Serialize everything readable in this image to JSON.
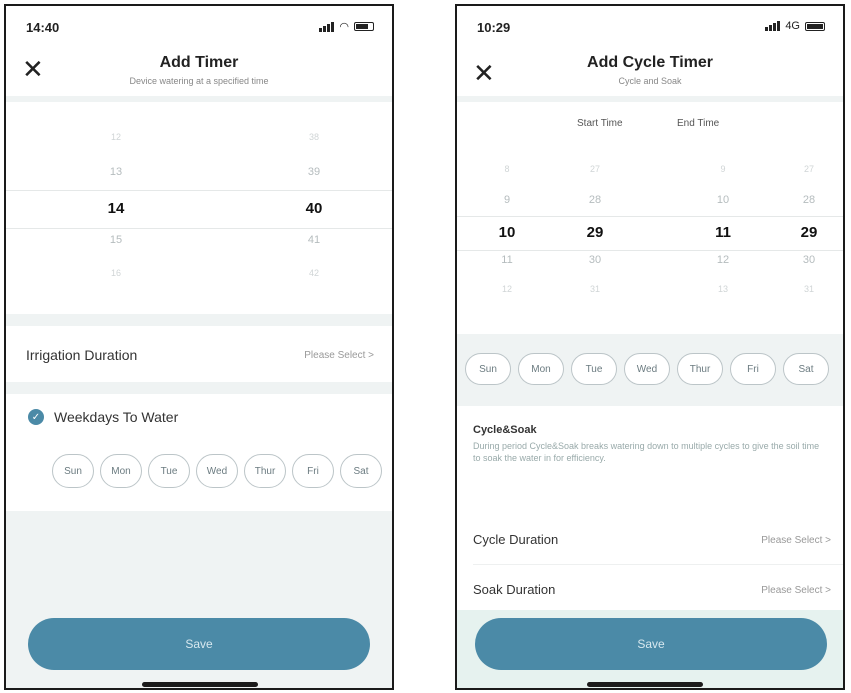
{
  "left": {
    "status": {
      "time": "14:40"
    },
    "header": {
      "title": "Add Timer",
      "subtitle": "Device watering at a specified time"
    },
    "picker": {
      "hours": [
        "12",
        "13",
        "14",
        "15",
        "16"
      ],
      "minutes": [
        "38",
        "39",
        "40",
        "41",
        "42"
      ],
      "selected_index": 2
    },
    "irrigation_duration": {
      "label": "Irrigation Duration",
      "value": "Please Select >"
    },
    "weekdays": {
      "label": "Weekdays To Water",
      "checked": true,
      "days": [
        "Sun",
        "Mon",
        "Tue",
        "Wed",
        "Thur",
        "Fri",
        "Sat"
      ]
    },
    "save_label": "Save"
  },
  "right": {
    "status": {
      "time": "10:29",
      "network": "4G"
    },
    "header": {
      "title": "Add Cycle Timer",
      "subtitle": "Cycle and Soak"
    },
    "picker": {
      "start_label": "Start Time",
      "end_label": "End Time",
      "start_hours": [
        "8",
        "9",
        "10",
        "11",
        "12"
      ],
      "start_minutes": [
        "27",
        "28",
        "29",
        "30",
        "31"
      ],
      "end_hours": [
        "9",
        "10",
        "11",
        "12",
        "13"
      ],
      "end_minutes": [
        "27",
        "28",
        "29",
        "30",
        "31"
      ],
      "selected_index": 2
    },
    "days": [
      "Sun",
      "Mon",
      "Tue",
      "Wed",
      "Thur",
      "Fri",
      "Sat"
    ],
    "cycle_soak": {
      "title": "Cycle&Soak",
      "description": "During period Cycle&Soak breaks watering down to multiple cycles to give the soil time to soak the water in for efficiency."
    },
    "cycle_duration": {
      "label": "Cycle Duration",
      "value": "Please Select >"
    },
    "soak_duration": {
      "label": "Soak Duration",
      "value": "Please Select >"
    },
    "save_label": "Save"
  },
  "colors": {
    "accent": "#4b8aa7",
    "band": "#eff3f3"
  }
}
